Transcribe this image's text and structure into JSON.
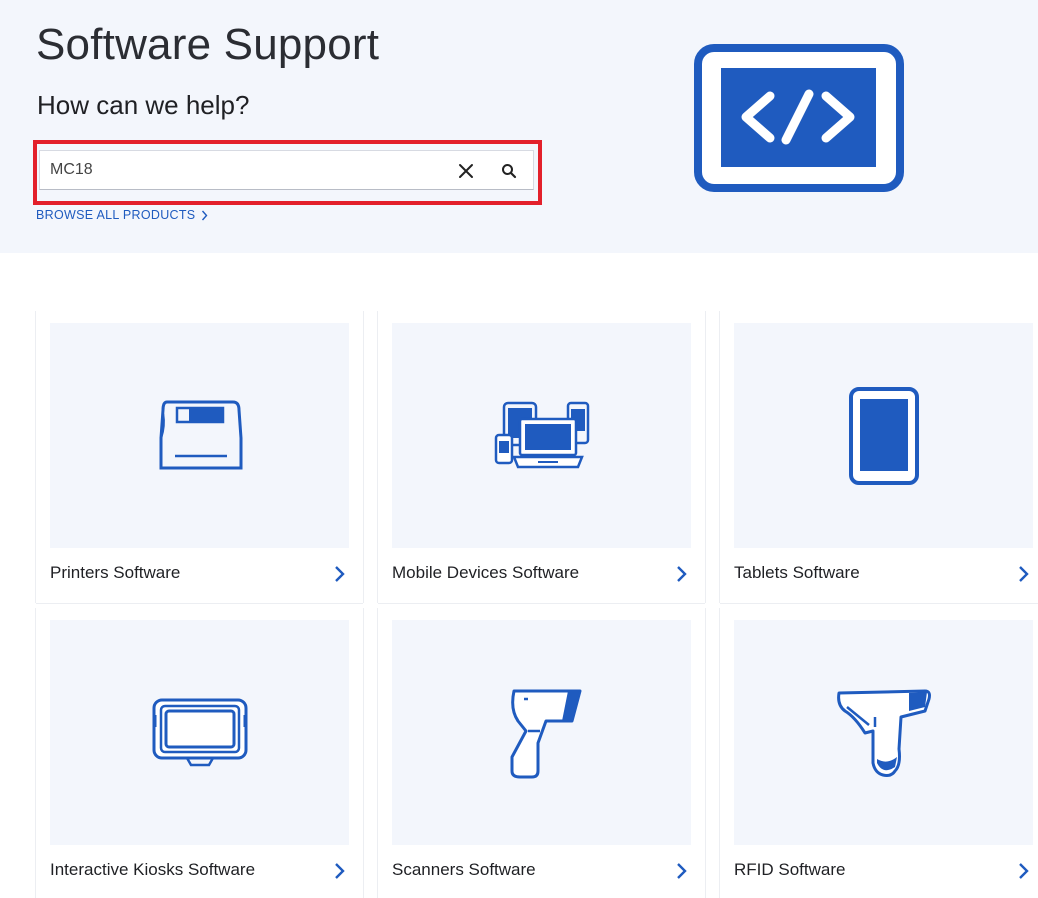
{
  "hero": {
    "title": "Software Support",
    "subtitle": "How can we help?",
    "search_value": "MC18",
    "browse_label": "BROWSE ALL PRODUCTS"
  },
  "colors": {
    "brand_blue": "#1f5bbf",
    "highlight_red": "#e3202b",
    "hero_bg": "#f3f6fc"
  },
  "categories": [
    {
      "label": "Printers Software",
      "icon": "printer-icon"
    },
    {
      "label": "Mobile Devices Software",
      "icon": "mobile-devices-icon"
    },
    {
      "label": "Tablets Software",
      "icon": "tablet-icon"
    },
    {
      "label": "Interactive Kiosks Software",
      "icon": "kiosk-icon"
    },
    {
      "label": "Scanners Software",
      "icon": "scanner-icon"
    },
    {
      "label": "RFID Software",
      "icon": "rfid-reader-icon"
    }
  ]
}
